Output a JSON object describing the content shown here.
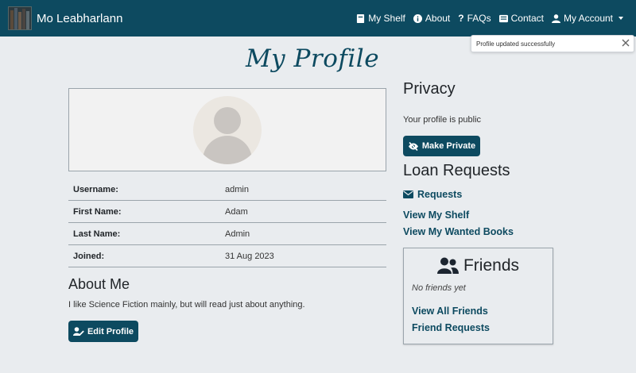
{
  "app": {
    "brand": "Mo Leabharlann"
  },
  "nav": {
    "items": [
      {
        "label": "My Shelf",
        "icon": "shelf-icon"
      },
      {
        "label": "About",
        "icon": "info-icon"
      },
      {
        "label": "FAQs",
        "icon": "question-icon"
      },
      {
        "label": "Contact",
        "icon": "contact-icon"
      },
      {
        "label": "My Account",
        "icon": "user-icon"
      }
    ]
  },
  "toast": {
    "message": "Profile updated successfully"
  },
  "page": {
    "title": "My Profile"
  },
  "profile": {
    "rows": [
      {
        "label": "Username:",
        "value": "admin"
      },
      {
        "label": "First Name:",
        "value": "Adam"
      },
      {
        "label": "Last Name:",
        "value": "Admin"
      },
      {
        "label": "Joined:",
        "value": "31 Aug 2023"
      }
    ]
  },
  "about": {
    "heading": "About Me",
    "text": "I like Science Fiction mainly, but will read just about anything.",
    "edit_label": "Edit Profile"
  },
  "privacy": {
    "heading": "Privacy",
    "status": "Your profile is public",
    "button_label": "Make Private"
  },
  "loans": {
    "heading": "Loan Requests",
    "requests_label": "Requests",
    "shelf_label": "View My Shelf",
    "wanted_label": "View My Wanted Books"
  },
  "friends": {
    "heading": "Friends",
    "empty_text": "No friends yet",
    "view_all_label": "View All Friends",
    "requests_label": "Friend Requests"
  },
  "colors": {
    "primary": "#0d4a60",
    "background": "#e9ecef"
  }
}
